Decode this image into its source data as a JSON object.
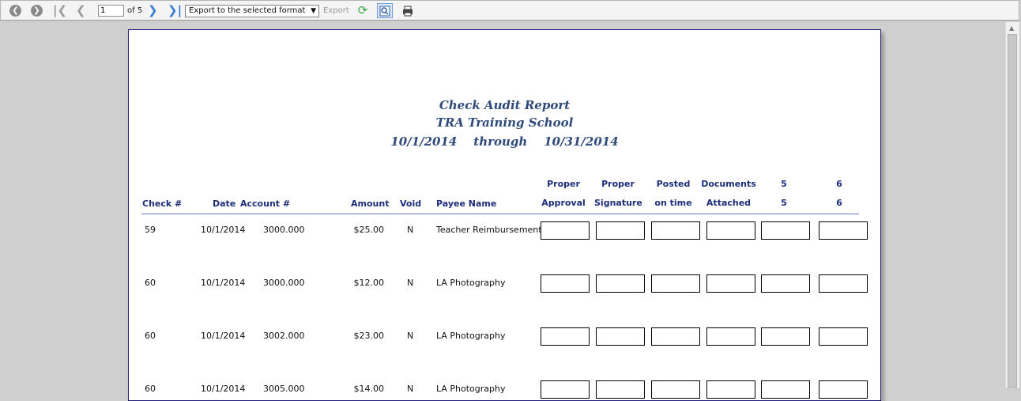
{
  "toolbar": {
    "page_current": "1",
    "page_of": "of 5",
    "export_format": "Export to the selected format",
    "export_label": "Export",
    "icons": [
      "back-icon",
      "forward-icon",
      "first-page-icon",
      "prev-page-icon",
      "next-page-icon",
      "last-page-icon",
      "refresh-icon",
      "find-icon",
      "print-icon"
    ]
  },
  "report": {
    "title": "Check Audit Report",
    "school": "TRA Training School",
    "period_from": "10/1/2014",
    "period_through": "through",
    "period_to": "10/31/2014",
    "columns": {
      "check": "Check #",
      "date": "Date",
      "account": "Account #",
      "amount": "Amount",
      "void": "Void",
      "payee": "Payee Name",
      "c1_top": "Proper",
      "c1_bot": "Approval",
      "c2_top": "Proper",
      "c2_bot": "Signature",
      "c3_top": "Posted",
      "c3_bot": "on time",
      "c4_top": "Documents",
      "c4_bot": "Attached",
      "c5_top": "5",
      "c5_bot": "5",
      "c6_top": "6",
      "c6_bot": "6"
    },
    "rows": [
      {
        "check": "59",
        "date": "10/1/2014",
        "account": "3000.000",
        "amount": "$25.00",
        "void": "N",
        "payee": "Teacher Reimbursement"
      },
      {
        "check": "60",
        "date": "10/1/2014",
        "account": "3000.000",
        "amount": "$12.00",
        "void": "N",
        "payee": "LA Photography"
      },
      {
        "check": "60",
        "date": "10/1/2014",
        "account": "3002.000",
        "amount": "$23.00",
        "void": "N",
        "payee": "LA Photography"
      },
      {
        "check": "60",
        "date": "10/1/2014",
        "account": "3005.000",
        "amount": "$14.00",
        "void": "N",
        "payee": "LA Photography"
      }
    ]
  }
}
